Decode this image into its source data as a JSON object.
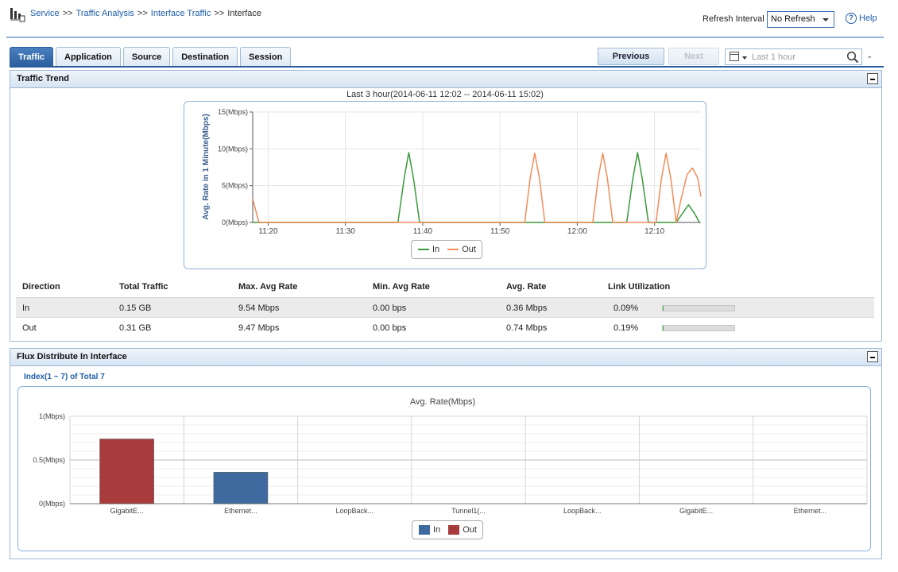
{
  "header": {
    "breadcrumb": [
      "Service",
      "Traffic Analysis",
      "Interface Traffic",
      "Interface"
    ],
    "breadcrumb_separator": ">>",
    "refresh_label": "Refresh Interval",
    "refresh_value": "No Refresh",
    "help_label": "Help"
  },
  "tabs": [
    {
      "label": "Traffic",
      "active": true
    },
    {
      "label": "Application",
      "active": false
    },
    {
      "label": "Source",
      "active": false
    },
    {
      "label": "Destination",
      "active": false
    },
    {
      "label": "Session",
      "active": false
    }
  ],
  "toolbar": {
    "previous_label": "Previous",
    "next_label": "Next",
    "time_range": "Last 1 hour"
  },
  "trend_panel": {
    "title": "Traffic Trend",
    "caption": "Last 3 hour(2014-06-11 12:02 -- 2014-06-11 15:02)"
  },
  "summary_table": {
    "columns": [
      "Direction",
      "Total Traffic",
      "Max. Avg Rate",
      "Min. Avg Rate",
      "Avg. Rate",
      "Link Utilization"
    ],
    "rows": [
      {
        "direction": "In",
        "total": "0.15 GB",
        "max": "9.54 Mbps",
        "min": "0.00 bps",
        "avg": "0.36 Mbps",
        "util": "0.09%",
        "util_fraction": 0.0009
      },
      {
        "direction": "Out",
        "total": "0.31 GB",
        "max": "9.47 Mbps",
        "min": "0.00 bps",
        "avg": "0.74 Mbps",
        "util": "0.19%",
        "util_fraction": 0.0019
      }
    ]
  },
  "flux_panel": {
    "title": "Flux Distribute In Interface",
    "index_text": "Index(1 ~ 7) of Total 7"
  },
  "colors": {
    "in_line": "#3a9a3a",
    "out_line": "#f28c5a",
    "in_bar": "#3e6aa0",
    "out_bar": "#a83c3c"
  },
  "chart_data": [
    {
      "type": "line",
      "ylabel": "Avg. Rate in 1 Minute(Mbps)",
      "ylim": [
        0,
        15
      ],
      "y_ticks": [
        "0(Mbps)",
        "5(Mbps)",
        "10(Mbps)",
        "15(Mbps)"
      ],
      "y_tick_values": [
        0,
        5,
        10,
        15
      ],
      "x_ticks": [
        "11:20",
        "11:30",
        "11:40",
        "11:50",
        "12:00",
        "12:10"
      ],
      "x_tick_minutes": [
        20,
        30,
        40,
        50,
        60,
        70
      ],
      "xlim_minutes": [
        18,
        76
      ],
      "grid": true,
      "legend": "bottom-center",
      "series": [
        {
          "name": "In",
          "points": [
            [
              18,
              0
            ],
            [
              36.8,
              0
            ],
            [
              37.6,
              6
            ],
            [
              38.2,
              9.5
            ],
            [
              38.8,
              6
            ],
            [
              39.6,
              0
            ],
            [
              66.4,
              0
            ],
            [
              67.2,
              6
            ],
            [
              67.8,
              9.5
            ],
            [
              68.4,
              6
            ],
            [
              69.2,
              0
            ],
            [
              72.8,
              0
            ],
            [
              73.8,
              1.5
            ],
            [
              74.4,
              2.4
            ],
            [
              75.2,
              1.2
            ],
            [
              75.8,
              0
            ]
          ]
        },
        {
          "name": "Out",
          "points": [
            [
              18,
              3.2
            ],
            [
              18.8,
              0
            ],
            [
              53.2,
              0
            ],
            [
              53.9,
              6
            ],
            [
              54.5,
              9.4
            ],
            [
              55.1,
              6
            ],
            [
              55.8,
              0
            ],
            [
              62,
              0
            ],
            [
              62.7,
              6
            ],
            [
              63.3,
              9.4
            ],
            [
              63.9,
              6
            ],
            [
              64.6,
              0
            ],
            [
              70.2,
              0
            ],
            [
              70.9,
              6
            ],
            [
              71.5,
              9.4
            ],
            [
              72.1,
              6
            ],
            [
              72.8,
              0
            ],
            [
              73.4,
              3
            ],
            [
              74.2,
              6.5
            ],
            [
              74.9,
              7.4
            ],
            [
              75.6,
              6
            ],
            [
              76,
              3.5
            ]
          ]
        }
      ]
    },
    {
      "type": "bar",
      "title": "Avg. Rate(Mbps)",
      "categories": [
        "GigabitE...",
        "Ethernet...",
        "LoopBack...",
        "Tunnel1(...",
        "LoopBack...",
        "GigabitE...",
        "Ethernet..."
      ],
      "y_ticks": [
        "0(Mbps)",
        "0.5(Mbps)",
        "1(Mbps)"
      ],
      "y_tick_values": [
        0,
        0.5,
        1
      ],
      "ylim": [
        0,
        1
      ],
      "grid": true,
      "legend": "bottom-center",
      "series": [
        {
          "name": "In",
          "values": [
            0,
            0.36,
            0,
            0,
            0,
            0,
            0
          ]
        },
        {
          "name": "Out",
          "values": [
            0.74,
            0,
            0,
            0,
            0,
            0,
            0
          ]
        }
      ]
    }
  ]
}
